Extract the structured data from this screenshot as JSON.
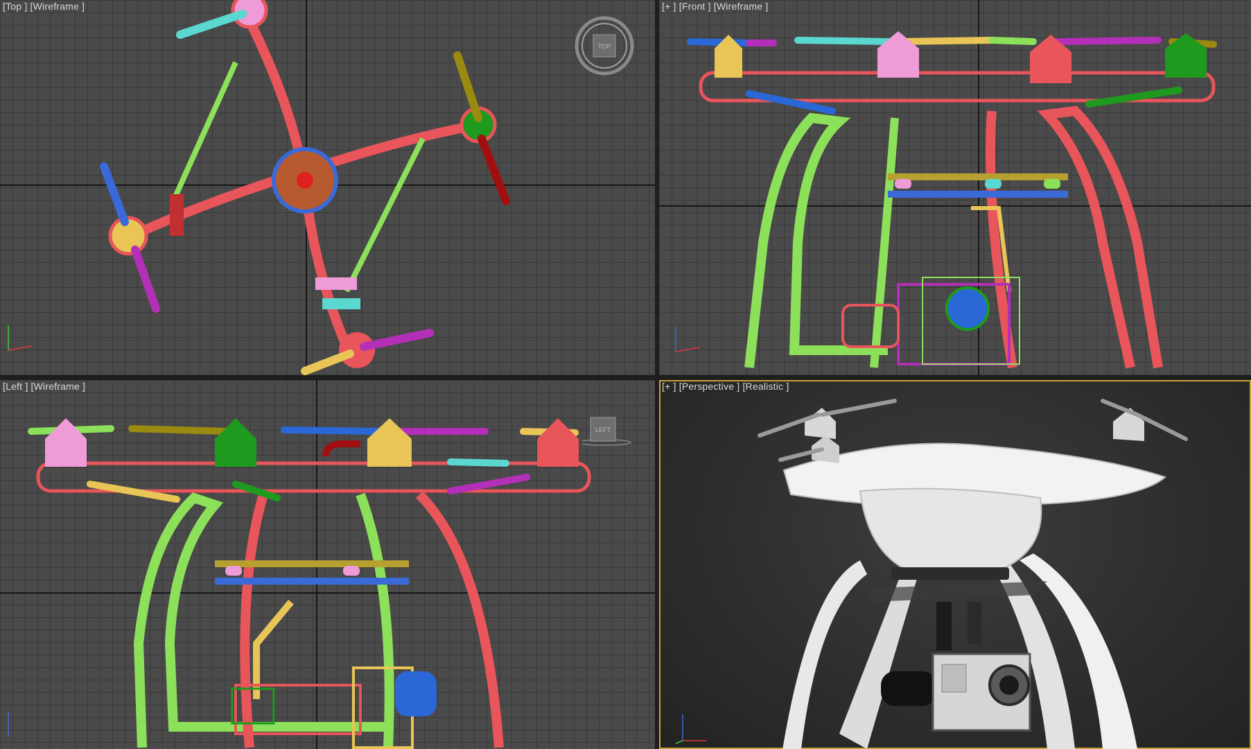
{
  "viewports": {
    "top": {
      "plus": "",
      "view": "[Top ]",
      "mode": "[Wireframe ]"
    },
    "front": {
      "plus": "[+ ]",
      "view": "[Front ]",
      "mode": "[Wireframe ]"
    },
    "left": {
      "plus": "",
      "view": "[Left ]",
      "mode": "[Wireframe ]"
    },
    "perspective": {
      "plus": "[+ ]",
      "view": "[Perspective ]",
      "mode": "[Realistic ]"
    }
  },
  "viewcube": {
    "top": "TOP",
    "left": "LEFT"
  },
  "colors": {
    "active_border": "#c7a23a",
    "grid_bg": "#4a4a4a",
    "wire_red": "#e8555a",
    "wire_green": "#8de05a"
  }
}
